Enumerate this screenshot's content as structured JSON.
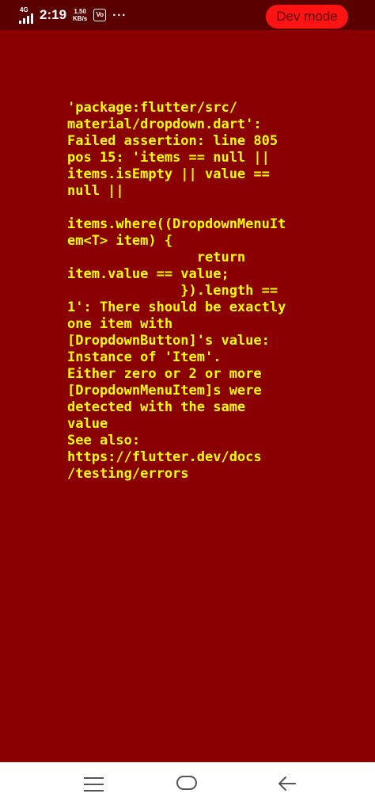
{
  "status_bar": {
    "network_label": "4G",
    "time": "2:19",
    "speed_value": "1.50",
    "speed_unit": "KB/s",
    "vpn_label": "Vo",
    "more": "···",
    "dev_mode_label": "Dev mode"
  },
  "error": {
    "message": "'package:flutter/src/\nmaterial/dropdown.dart':\nFailed assertion: line 805\npos 15: 'items == null ||\nitems.isEmpty || value ==\nnull ||\n\nitems.where((DropdownMenuIt\nem<T> item) {\n                return\nitem.value == value;\n              }).length ==\n1': There should be exactly\none item with\n[DropdownButton]'s value:\nInstance of 'Item'.\nEither zero or 2 or more\n[DropdownMenuItem]s were\ndetected with the same\nvalue\nSee also:\nhttps://flutter.dev/docs\n/testing/errors"
  },
  "nav_bar": {
    "menu_icon": "menu-icon",
    "home_icon": "home-icon",
    "back_icon": "back-arrow-icon"
  },
  "colors": {
    "background": "#8a0000",
    "status_bar": "#5a0000",
    "error_text": "#ffff00",
    "dev_pill": "#ff1414"
  }
}
